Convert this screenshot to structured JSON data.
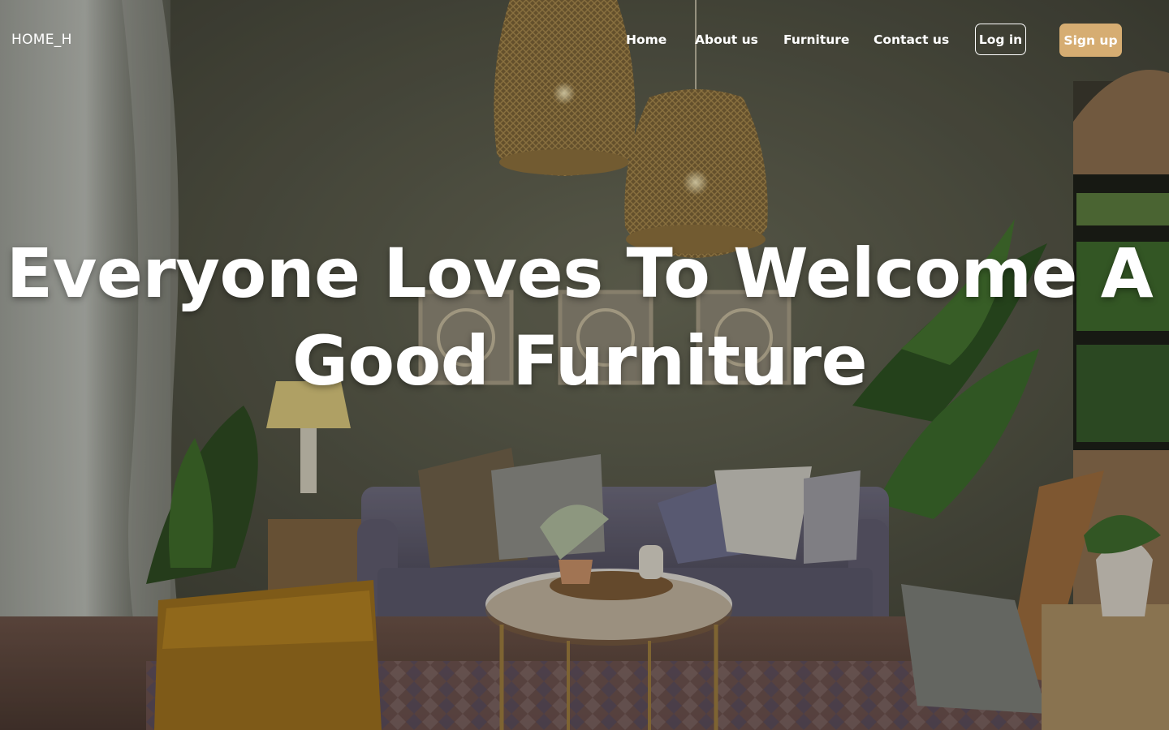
{
  "brand": {
    "name": "HOME_H"
  },
  "nav": {
    "links": [
      {
        "label": "Home"
      },
      {
        "label": "About us"
      },
      {
        "label": "Furniture"
      },
      {
        "label": "Contact us"
      }
    ],
    "login_label": "Log in",
    "signup_label": "Sign up"
  },
  "hero": {
    "headline_line1": "Everyone Loves To Welcome A",
    "headline_line2": "Good Furniture",
    "background_image": "living-room-photo"
  },
  "colors": {
    "accent": "#d6ad72",
    "text": "#ffffff",
    "wall": "#5a5b4c"
  }
}
